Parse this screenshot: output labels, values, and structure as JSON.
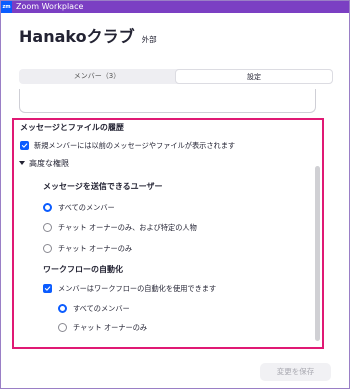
{
  "window": {
    "app_icon_text": "zm",
    "title": "Zoom Workplace"
  },
  "channel": {
    "name": "Hanakoクラブ",
    "badge": "外部"
  },
  "tabs": [
    {
      "label": "メンバー（3）",
      "active": false
    },
    {
      "label": "設定",
      "active": true
    }
  ],
  "history": {
    "title": "メッセージとファイルの履歴",
    "option_label": "新規メンバーには以前のメッセージやファイルが表示されます",
    "option_checked": true
  },
  "advanced": {
    "title": "高度な権限",
    "expanded": true,
    "send_permission": {
      "title": "メッセージを送信できるユーザー",
      "options": [
        {
          "label": "すべてのメンバー",
          "selected": true
        },
        {
          "label": "チャット オーナーのみ、および特定の人物",
          "selected": false
        },
        {
          "label": "チャット オーナーのみ",
          "selected": false
        }
      ]
    },
    "workflow": {
      "title": "ワークフローの自動化",
      "option_label": "メンバーはワークフローの自動化を使用できます",
      "option_checked": true,
      "options": [
        {
          "label": "すべてのメンバー",
          "selected": true
        },
        {
          "label": "チャット オーナーのみ",
          "selected": false
        }
      ]
    }
  },
  "footer": {
    "save_label": "変更を保存",
    "save_enabled": false
  },
  "colors": {
    "title_bar": "#7b3fc3",
    "accent": "#0b5cff",
    "highlight": "#e01974"
  }
}
